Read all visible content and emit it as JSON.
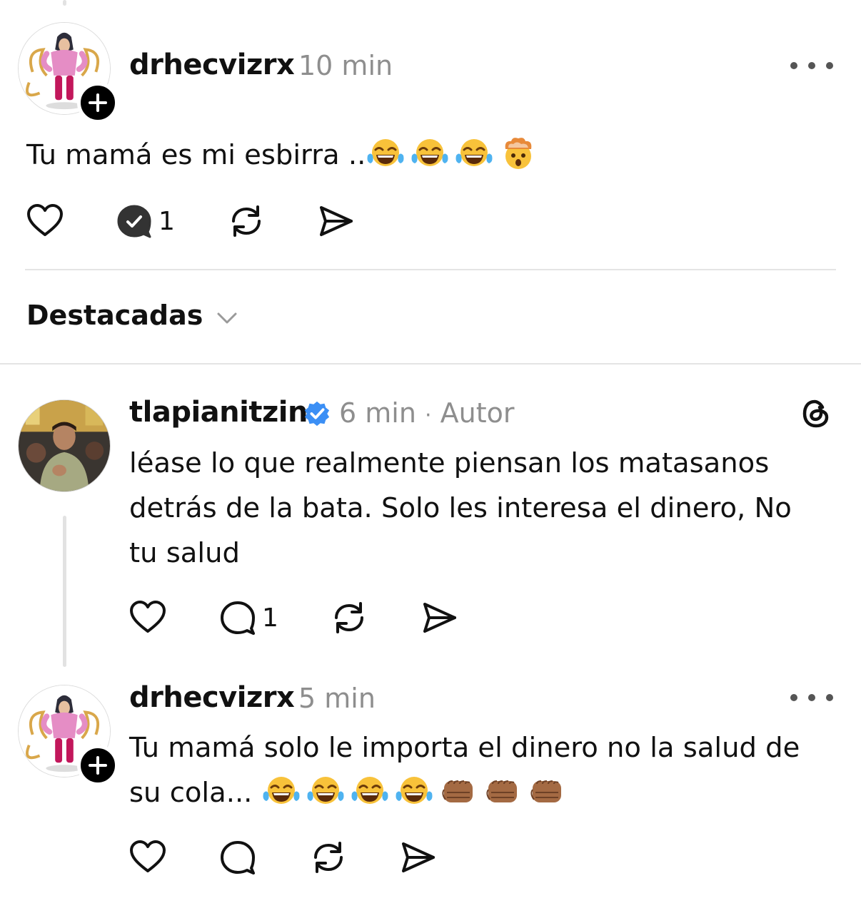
{
  "post_main": {
    "username": "drhecvizrx",
    "time": "10 min",
    "text": "Tu mamá es mi esbirra ..",
    "emojis": [
      "tears-of-joy-emoji",
      "tears-of-joy-emoji",
      "tears-of-joy-emoji",
      "mind-blown-emoji"
    ],
    "reply_count": "1"
  },
  "sort": {
    "label": "Destacadas"
  },
  "reply_1": {
    "username": "tlapianitzin",
    "time": "6 min",
    "separator": "·",
    "author_label": "Autor",
    "lines": [
      "léase lo que realmente piensan los matasanos",
      "detrás de la bata. Solo les interesa el dinero, No",
      "tu salud"
    ],
    "reply_count": "1"
  },
  "reply_2": {
    "username": "drhecvizrx",
    "time": "5 min",
    "line1": "Tu mamá solo le importa el dinero no la salud de",
    "line2": "su cola... ",
    "emojis": [
      "tears-of-joy-emoji",
      "tears-of-joy-emoji",
      "tears-of-joy-emoji",
      "tears-of-joy-emoji",
      "oncoming-fist-emoji",
      "oncoming-fist-emoji",
      "oncoming-fist-emoji"
    ]
  },
  "colors": {
    "verified": "#3b8ff5",
    "meta_gray": "#8e8e8e",
    "text": "#111111",
    "divider": "#e4e4e4"
  }
}
